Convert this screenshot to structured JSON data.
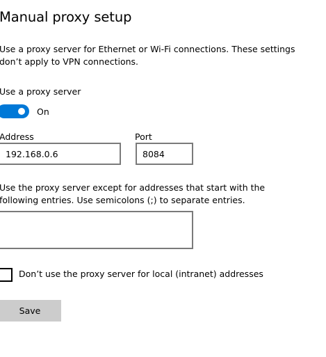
{
  "page": {
    "title": "Manual proxy setup",
    "description": "Use a proxy server for Ethernet or Wi-Fi connections. These settings don’t apply to VPN connections."
  },
  "proxy_toggle": {
    "label": "Use a proxy server",
    "state_label": "On",
    "enabled": true,
    "accent_color": "#0078d7"
  },
  "address": {
    "label": "Address",
    "value": "192.168.0.6"
  },
  "port": {
    "label": "Port",
    "value": "8084"
  },
  "exceptions": {
    "label": "Use the proxy server except for addresses that start with the following entries. Use semicolons (;) to separate entries.",
    "value": ""
  },
  "local_bypass": {
    "label": "Don’t use the proxy server for local (intranet) addresses",
    "checked": false
  },
  "save_button": {
    "label": "Save"
  }
}
